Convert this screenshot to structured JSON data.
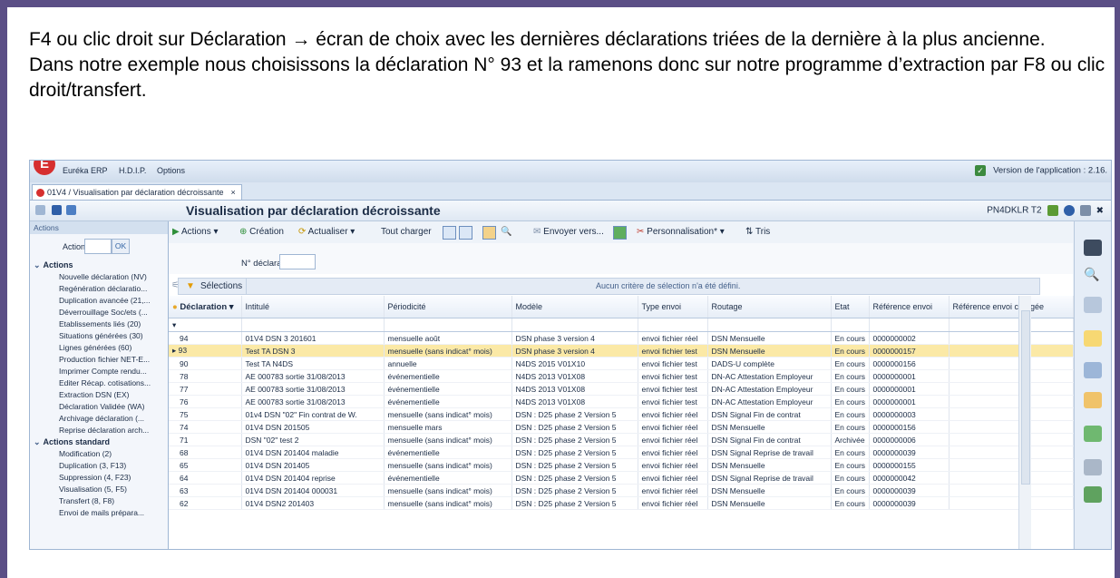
{
  "intro": {
    "line1": "F4 ou clic droit sur Déclaration → écran de choix avec les dernières déclarations triées de la dernière à la plus ancienne.",
    "line2": "Dans notre exemple nous choisissons la déclaration N° 93 et la ramenons donc sur notre programme d’extraction par F8 ou clic droit/transfert."
  },
  "app": {
    "logo": "E",
    "menu": [
      "Euréka ERP",
      "H.D.I.P.",
      "Options"
    ],
    "version": "Version de l'application : 2.16.",
    "tab_label": "01V4 / Visualisation par déclaration décroissante",
    "tab_close": "×",
    "window_title": "Visualisation par déclaration décroissante",
    "user": "PN4DKLR T2",
    "close_glyph": "✖"
  },
  "left_panel": {
    "header": "Actions",
    "action_label": "Action",
    "ok_label": "OK",
    "group_actions": "Actions",
    "actions": [
      "Nouvelle déclaration (NV)",
      "Regénération déclaratio...",
      "Duplication avancée (21,...",
      "Déverrouillage Soc/ets (...",
      "Etablissements liés (20)",
      "Situations générées (30)",
      "Lignes générées (60)",
      "Production fichier NET-E...",
      "Imprimer Compte rendu...",
      "Editer Récap. cotisations...",
      "Extraction DSN (EX)",
      "Déclaration Validée (WA)",
      "Archivage déclaration (...",
      "Reprise déclaration arch..."
    ],
    "group_standard": "Actions standard",
    "standard": [
      "Modification (2)",
      "Duplication (3, F13)",
      "Suppression (4, F23)",
      "Visualisation (5, F5)",
      "Transfert (8, F8)",
      "Envoi de mails prépara..."
    ]
  },
  "toolbar": {
    "actions": "Actions",
    "creation": "Création",
    "actualiser": "Actualiser",
    "tout_charger": "Tout charger",
    "envoyer": "Envoyer vers...",
    "personnalisation": "Personnalisation*",
    "tris": "Tris"
  },
  "filter": {
    "label": "N° déclaration",
    "value": ""
  },
  "selection": {
    "button": "Sélections",
    "message": "Aucun critère de sélection n'a été défini."
  },
  "grid": {
    "columns": [
      "Déclaration",
      "Intitulé",
      "Périodicité",
      "Modèle",
      "Type envoi",
      "Routage",
      "Etat",
      "Référence envoi",
      "Référence envoi corrigée"
    ],
    "rows": [
      [
        "94",
        "01V4 DSN 3    201601",
        "mensuelle août",
        "DSN phase 3 version 4",
        "envoi fichier réel",
        "DSN Mensuelle",
        "En cours",
        "0000000002",
        ""
      ],
      [
        "93",
        "Test TA DSN 3",
        "mensuelle (sans indicat° mois)",
        "DSN phase 3 version 4",
        "envoi fichier test",
        "DSN Mensuelle",
        "En cours",
        "0000000157",
        ""
      ],
      [
        "90",
        "Test TA N4DS",
        "annuelle",
        "N4DS 2015 V01X10",
        "envoi fichier test",
        "DADS-U complète",
        "En cours",
        "0000000156",
        ""
      ],
      [
        "78",
        "AE 000783 sortie 31/08/2013",
        "événementielle",
        "N4DS 2013 V01X08",
        "envoi fichier test",
        "DN-AC Attestation Employeur",
        "En cours",
        "0000000001",
        ""
      ],
      [
        "77",
        "AE 000783 sortie 31/08/2013",
        "événementielle",
        "N4DS 2013 V01X08",
        "envoi fichier test",
        "DN-AC Attestation Employeur",
        "En cours",
        "0000000001",
        ""
      ],
      [
        "76",
        "AE 000783 sortie 31/08/2013",
        "événementielle",
        "N4DS 2013 V01X08",
        "envoi fichier test",
        "DN-AC Attestation Employeur",
        "En cours",
        "0000000001",
        ""
      ],
      [
        "75",
        "01v4 DSN \"02\" Fin contrat de W.",
        "mensuelle (sans indicat° mois)",
        "DSN : D25   phase 2 Version 5",
        "envoi fichier réel",
        "DSN Signal Fin de contrat",
        "En cours",
        "0000000003",
        ""
      ],
      [
        "74",
        "01V4 DSN 201505",
        "mensuelle mars",
        "DSN : D25   phase 2 Version 5",
        "envoi fichier réel",
        "DSN Mensuelle",
        "En cours",
        "0000000156",
        ""
      ],
      [
        "71",
        "DSN \"02\" test 2",
        "mensuelle (sans indicat° mois)",
        "DSN : D25   phase 2 Version 5",
        "envoi fichier réel",
        "DSN Signal Fin de contrat",
        "Archivée",
        "0000000006",
        ""
      ],
      [
        "68",
        "01V4 DSN 201404  maladie",
        "événementielle",
        "DSN : D25   phase 2 Version 5",
        "envoi fichier réel",
        "DSN Signal Reprise de travail",
        "En cours",
        "0000000039",
        ""
      ],
      [
        "65",
        "01V4 DSN 201405",
        "mensuelle (sans indicat° mois)",
        "DSN : D25   phase 2 Version 5",
        "envoi fichier réel",
        "DSN Mensuelle",
        "En cours",
        "0000000155",
        ""
      ],
      [
        "64",
        "01V4 DSN 201404  reprise",
        "événementielle",
        "DSN : D25   phase 2 Version 5",
        "envoi fichier réel",
        "DSN Signal Reprise de travail",
        "En cours",
        "0000000042",
        ""
      ],
      [
        "63",
        "01V4 DSN 201404 000031",
        "mensuelle (sans indicat° mois)",
        "DSN : D25   phase 2 Version 5",
        "envoi fichier réel",
        "DSN Mensuelle",
        "En cours",
        "0000000039",
        ""
      ],
      [
        "62",
        "01V4 DSN2 201403",
        "mensuelle (sans indicat° mois)",
        "DSN : D25   phase 2 Version 5",
        "envoi fichier réel",
        "DSN Mensuelle",
        "En cours",
        "0000000039",
        ""
      ]
    ]
  }
}
